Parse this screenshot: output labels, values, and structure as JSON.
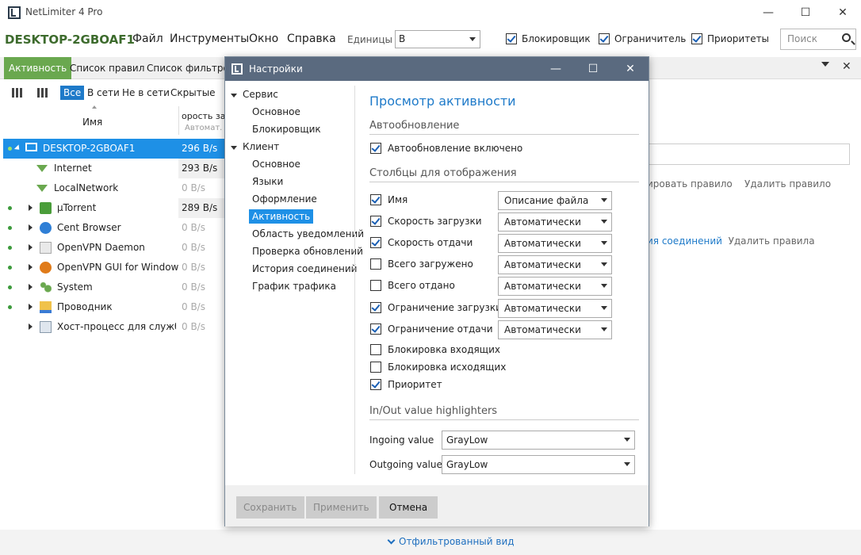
{
  "app": {
    "title": "NetLimiter 4 Pro",
    "machine": "DESKTOP-2GBOAF1",
    "menu": [
      "Файл",
      "Инструменты",
      "Окно",
      "Справка"
    ],
    "units_label": "Единицы",
    "units_value": "B",
    "toggles": [
      {
        "label": "Блокировщик",
        "checked": true
      },
      {
        "label": "Ограничитель",
        "checked": true
      },
      {
        "label": "Приоритеты",
        "checked": true
      }
    ],
    "search_placeholder": "Поиск"
  },
  "tabs": [
    "Активность",
    "Список правил",
    "Список фильтров"
  ],
  "filters": [
    "Все",
    "В сети",
    "Не в сети",
    "Скрытые"
  ],
  "columns": {
    "name": "Имя",
    "speed": "орость загр",
    "speed_sub": "Автомат. е"
  },
  "rows": [
    {
      "name": "DESKTOP-2GBOAF1",
      "speed": "296 B/s",
      "selected": true,
      "online": true
    },
    {
      "name": "Internet",
      "speed": "293 B/s",
      "online": false
    },
    {
      "name": "LocalNetwork",
      "speed": "0 B/s",
      "online": false
    },
    {
      "name": "µTorrent",
      "speed": "289 B/s",
      "online": true
    },
    {
      "name": "Cent Browser",
      "speed": "0 B/s",
      "online": true
    },
    {
      "name": "OpenVPN Daemon",
      "speed": "0 B/s",
      "online": true
    },
    {
      "name": "OpenVPN GUI for Windows",
      "speed": "0 B/s",
      "online": true
    },
    {
      "name": "System",
      "speed": "0 B/s",
      "online": true
    },
    {
      "name": "Проводник",
      "speed": "0 B/s",
      "online": true
    },
    {
      "name": "Хост-процесс для служб W",
      "speed": "0 B/s",
      "online": false
    }
  ],
  "right_panel": {
    "links1": [
      "ировать правило",
      "Удалить правило"
    ],
    "links2": [
      "ия соединений",
      "Удалить правила"
    ]
  },
  "bottom": {
    "filtered_view": "Отфильтрованный вид"
  },
  "dialog": {
    "title": "Настройки",
    "tree": {
      "service": "Сервис",
      "service_items": [
        "Основное",
        "Блокировщик"
      ],
      "client": "Клиент",
      "client_items": [
        "Основное",
        "Языки",
        "Оформление",
        "Активность",
        "Область уведомлений",
        "Проверка обновлений",
        "История соединений",
        "График трафика"
      ],
      "selected": "Активность"
    },
    "pane_title": "Просмотр активности",
    "sections": {
      "autoupdate": "Автообновление",
      "columns": "Столбцы для отображения",
      "highlighters": "In/Out value highlighters"
    },
    "autoupdate_option": "Автообновление включено",
    "columns": [
      {
        "label": "Имя",
        "checked": true,
        "dropdown": "Описание файла"
      },
      {
        "label": "Скорость загрузки",
        "checked": true,
        "dropdown": "Автоматически"
      },
      {
        "label": "Скорость отдачи",
        "checked": true,
        "dropdown": "Автоматически"
      },
      {
        "label": "Всего загружено",
        "checked": false,
        "dropdown": "Автоматически"
      },
      {
        "label": "Всего отдано",
        "checked": false,
        "dropdown": "Автоматически"
      },
      {
        "label": "Ограничение загрузки",
        "checked": true,
        "dropdown": "Автоматически"
      },
      {
        "label": "Ограничение отдачи",
        "checked": true,
        "dropdown": "Автоматически"
      },
      {
        "label": "Блокировка входящих",
        "checked": false
      },
      {
        "label": "Блокировка исходящих",
        "checked": false
      },
      {
        "label": "Приоритет",
        "checked": true
      }
    ],
    "ingoing_label": "Ingoing value",
    "ingoing_value": "GrayLow",
    "outgoing_label": "Outgoing value",
    "outgoing_value": "GrayLow",
    "buttons": {
      "save": "Сохранить",
      "apply": "Применить",
      "cancel": "Отмена"
    }
  }
}
